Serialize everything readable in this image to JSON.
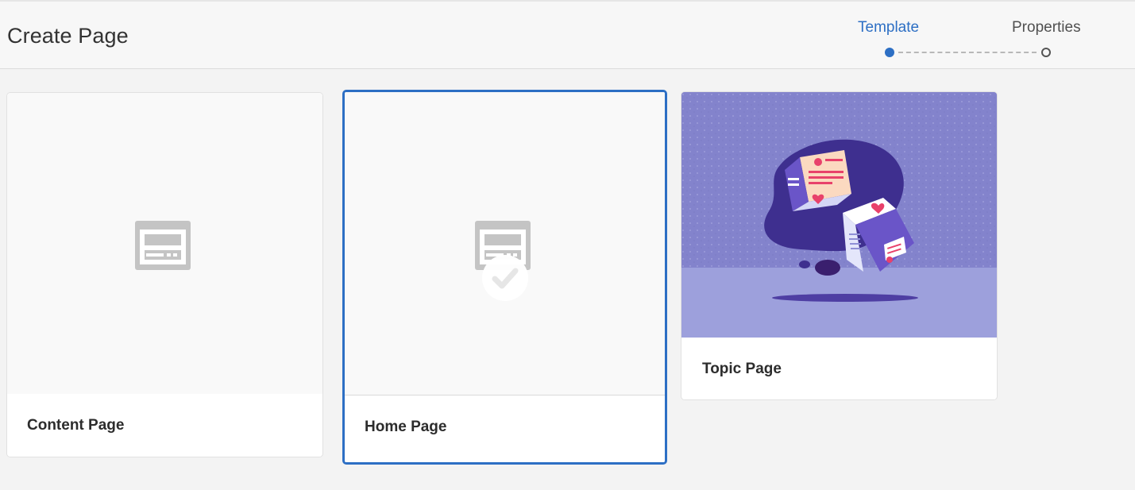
{
  "header": {
    "title": "Create Page",
    "steps": [
      {
        "label": "Template",
        "state": "active"
      },
      {
        "label": "Properties",
        "state": "pending"
      }
    ]
  },
  "templates": [
    {
      "title": "Content Page",
      "thumbnail": "template-icon",
      "selected": false
    },
    {
      "title": "Home Page",
      "thumbnail": "template-icon",
      "selected": true
    },
    {
      "title": "Topic Page",
      "thumbnail": "illustration-cubes",
      "selected": false
    }
  ],
  "colors": {
    "accent": "#2d6fc4",
    "background": "#f3f3f3",
    "topic_thumbnail_bg": "#8787cf"
  }
}
